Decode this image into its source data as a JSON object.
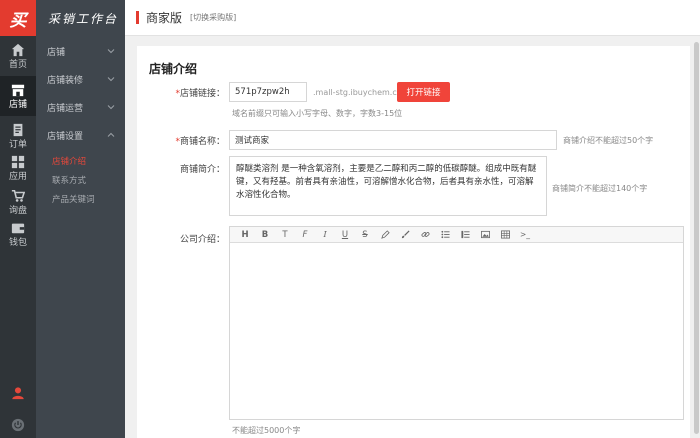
{
  "brand": {
    "logo": "买",
    "workspace_title": "采销工作台"
  },
  "rail": {
    "items": [
      {
        "label": "首页",
        "icon": "home-icon"
      },
      {
        "label": "店铺",
        "icon": "store-icon"
      },
      {
        "label": "订单",
        "icon": "document-icon"
      },
      {
        "label": "应用",
        "icon": "grid-icon"
      },
      {
        "label": "询盘",
        "icon": "cart-icon"
      },
      {
        "label": "钱包",
        "icon": "wallet-icon"
      }
    ],
    "bottom_icons": [
      "user-icon",
      "power-icon"
    ]
  },
  "subnav": {
    "groups": [
      "店铺",
      "店铺装修",
      "店铺运营",
      "店铺设置"
    ],
    "sub_items": [
      "店铺介绍",
      "联系方式",
      "产品关键词"
    ]
  },
  "header": {
    "title": "商家版",
    "switch_label": "[切换采购版]"
  },
  "page": {
    "title": "店铺介绍",
    "store_link": {
      "label": "店铺链接：",
      "value": "571p7zpw2h",
      "domain_suffix": ".mall-stg.ibuychem.com",
      "open_button": "打开链接",
      "hint": "域名前缀只可输入小写字母、数字，字数3-15位"
    },
    "store_name": {
      "label": "商铺名称：",
      "value": "测试商家",
      "hint": "商铺介绍不能超过50个字"
    },
    "store_intro": {
      "label": "商铺简介：",
      "value": "醇醚类溶剂 是一种含氧溶剂，主要是乙二醇和丙二醇的低碳醇醚。组成中既有醚键，又有羟基。前者具有亲油性，可溶解憎水化合物，后者具有亲水性，可溶解水溶性化合物。",
      "hint": "商铺简介不能超过140个字"
    },
    "company_intro": {
      "label": "公司介绍：",
      "hint": "不能超过5000个字",
      "toolbar": [
        "H",
        "B",
        "T",
        "F",
        "I",
        "U",
        "S",
        "pen",
        "brush",
        "link",
        "ul",
        "ol",
        "image",
        "table",
        ">_"
      ]
    }
  },
  "colors": {
    "accent": "#e33b2f",
    "rail_bg": "#2f3438",
    "subnav_bg": "#3f464d"
  }
}
